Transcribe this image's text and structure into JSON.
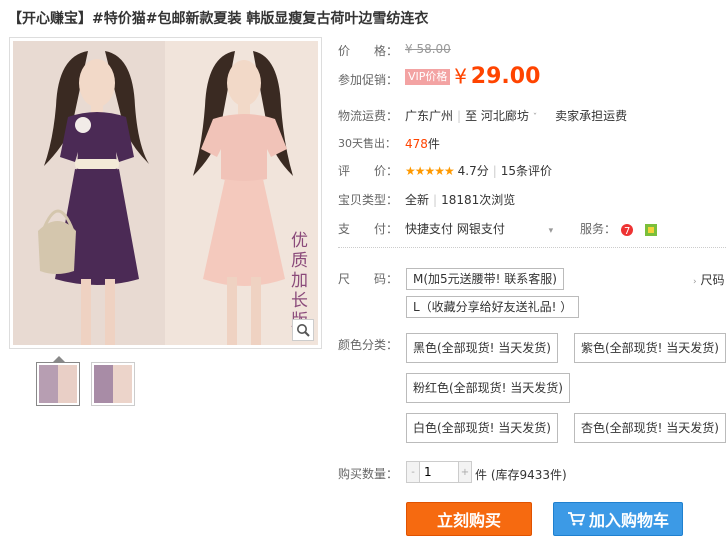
{
  "title": "【开心赚宝】#特价猫#包邮新款夏装 韩版显瘦复古荷叶边雪纺连衣",
  "image": {
    "vertical_text": "优质加长版",
    "zoom_icon": "magnifier-icon"
  },
  "price": {
    "label": "价　　格：",
    "value": "¥ 58.00"
  },
  "promo": {
    "label": "参加促销：",
    "tag": "VIP价格",
    "currency": "¥",
    "value": "29.00"
  },
  "shipping": {
    "label": "物流运费：",
    "from": "广东广州",
    "to_prefix": "至",
    "to": "河北廊坊",
    "note": "卖家承担运费"
  },
  "sold": {
    "label": "30天售出：",
    "count": "478",
    "unit": "件"
  },
  "rating": {
    "label": "评　　价：",
    "stars": "★★★★★",
    "score": "4.7分",
    "reviews": "15条评价"
  },
  "type": {
    "label": "宝贝类型：",
    "condition": "全新",
    "views": "18181次浏览"
  },
  "payment": {
    "label": "支　　付：",
    "methods": "快捷支付 网银支付",
    "service_label": "服务："
  },
  "size": {
    "label": "尺　　码：",
    "options": [
      "M(加5元送腰带! 联系客服)",
      "L（收藏分享给好友送礼品! ）"
    ],
    "chart_link": "尺码"
  },
  "color": {
    "label": "颜色分类：",
    "options": [
      "黑色(全部现货! 当天发货)",
      "紫色(全部现货! 当天发货)",
      "粉红色(全部现货! 当天发货)",
      "白色(全部现货! 当天发货)",
      "杏色(全部现货! 当天发货)"
    ]
  },
  "quantity": {
    "label": "购买数量：",
    "value": "1",
    "minus": "-",
    "plus": "+",
    "stock": "件 (库存9433件)"
  },
  "buttons": {
    "buy": "立刻购买",
    "cart": "加入购物车"
  },
  "colors": {
    "accent": "#ff4400",
    "buy_bg": "#f66a10",
    "cart_bg": "#3c9ae6",
    "vip_bg": "#f3a3a3"
  }
}
